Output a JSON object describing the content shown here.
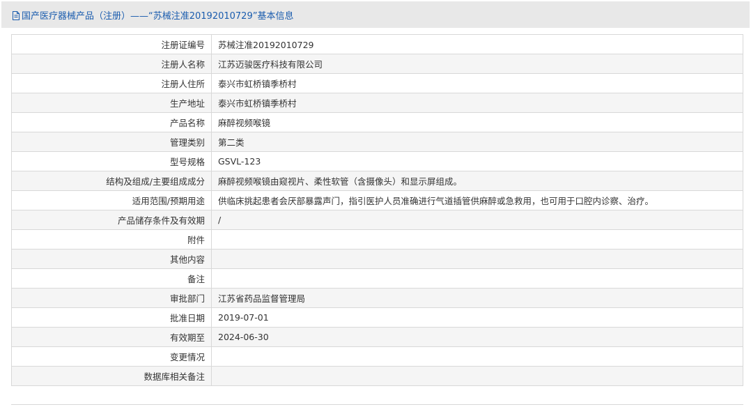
{
  "header": {
    "title": "国产医疗器械产品（注册）——“苏械注准20192010729”基本信息",
    "icon": "document-icon",
    "color": "#1a5cae"
  },
  "rows": [
    {
      "label": "注册证编号",
      "value": "苏械注准20192010729"
    },
    {
      "label": "注册人名称",
      "value": "江苏迈骏医疗科技有限公司"
    },
    {
      "label": "注册人住所",
      "value": "泰兴市虹桥镇季桥村"
    },
    {
      "label": "生产地址",
      "value": "泰兴市虹桥镇季桥村"
    },
    {
      "label": "产品名称",
      "value": "麻醉视频喉镜"
    },
    {
      "label": "管理类别",
      "value": "第二类"
    },
    {
      "label": "型号规格",
      "value": "GSVL-123"
    },
    {
      "label": "结构及组成/主要组成成分",
      "value": "麻醉视频喉镜由窥视片、柔性软管（含摄像头）和显示屏组成。"
    },
    {
      "label": "适用范围/预期用途",
      "value": "供临床挑起患者会厌部暴露声门，指引医护人员准确进行气道插管供麻醉或急救用，也可用于口腔内诊察、治疗。"
    },
    {
      "label": "产品储存条件及有效期",
      "value": "/"
    },
    {
      "label": "附件",
      "value": ""
    },
    {
      "label": "其他内容",
      "value": ""
    },
    {
      "label": "备注",
      "value": ""
    },
    {
      "label": "审批部门",
      "value": "江苏省药品监督管理局"
    },
    {
      "label": "批准日期",
      "value": "2019-07-01"
    },
    {
      "label": "有效期至",
      "value": "2024-06-30"
    },
    {
      "label": "变更情况",
      "value": ""
    },
    {
      "label": "数据库相关备注",
      "value": ""
    }
  ]
}
